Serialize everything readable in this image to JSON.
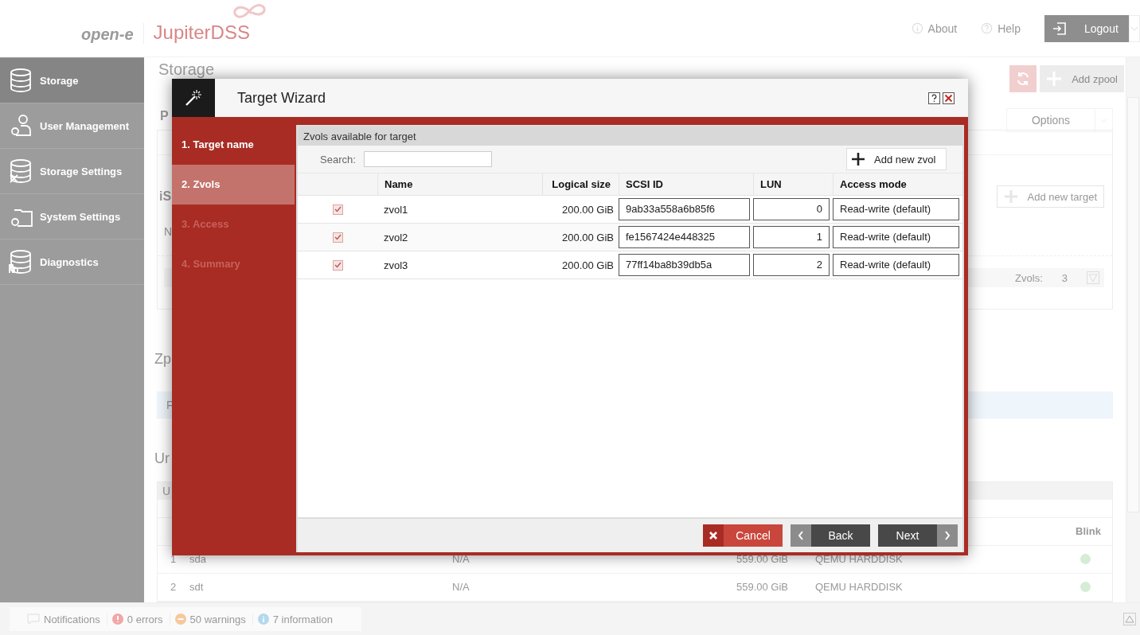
{
  "header": {
    "brand": "open-e",
    "product": "JupiterDSS",
    "links": [
      {
        "label": "About",
        "kind": "about"
      },
      {
        "label": "Help",
        "kind": "help"
      }
    ],
    "logout": "Logout"
  },
  "sidebar": {
    "items": [
      {
        "label": "Storage",
        "kind": "storage",
        "selected": true
      },
      {
        "label": "User Management",
        "kind": "users",
        "selected": false
      },
      {
        "label": "Storage Settings",
        "kind": "storage-settings",
        "selected": false
      },
      {
        "label": "System Settings",
        "kind": "system",
        "selected": false
      },
      {
        "label": "Diagnostics",
        "kind": "diagnostics",
        "selected": false
      }
    ]
  },
  "page": {
    "title": "Storage",
    "add_zpool": "Add zpool",
    "section_fragment": "P",
    "options": "Options",
    "target_fragment": "iS",
    "add_target": "Add new target",
    "name_fragment": "N",
    "zvols_label": "Zvols:",
    "zvols_count": "3",
    "zpools_fragment": "Zp",
    "info_fragment": "F",
    "unused_fragment": "Ur",
    "disks": {
      "header_fragment": "U",
      "blink_header": "Blink",
      "rows": [
        {
          "index": "1",
          "name": "sda",
          "column_3": "N/A",
          "size": "559.00 GiB",
          "model": "QEMU HARDDISK"
        },
        {
          "index": "2",
          "name": "sdt",
          "column_3": "N/A",
          "size": "559.00 GiB",
          "model": "QEMU HARDDISK"
        }
      ]
    }
  },
  "wizard": {
    "title": "Target Wizard",
    "steps": [
      {
        "label": "1. Target name",
        "selected": false,
        "disabled": false
      },
      {
        "label": "2. Zvols",
        "selected": true,
        "disabled": false
      },
      {
        "label": "3. Access",
        "selected": false,
        "disabled": true
      },
      {
        "label": "4. Summary",
        "selected": false,
        "disabled": true
      }
    ],
    "panel_title": "Zvols available for target",
    "search_label": "Search:",
    "add_zvol": "Add new zvol",
    "columns": [
      "Name",
      "Logical size",
      "SCSI ID",
      "LUN",
      "Access mode"
    ],
    "rows": [
      {
        "checked": true,
        "name": "zvol1",
        "size": "200.00 GiB",
        "scsi_id": "9ab33a558a6b85f6",
        "lun": "0",
        "access_mode": "Read-write (default)"
      },
      {
        "checked": true,
        "name": "zvol2",
        "size": "200.00 GiB",
        "scsi_id": "fe1567424e448325",
        "lun": "1",
        "access_mode": "Read-write (default)"
      },
      {
        "checked": true,
        "name": "zvol3",
        "size": "200.00 GiB",
        "scsi_id": "77ff14ba8b39db5a",
        "lun": "2",
        "access_mode": "Read-write (default)"
      }
    ],
    "cancel": "Cancel",
    "back": "Back",
    "next": "Next"
  },
  "status_bar": {
    "notifications": "Notifications",
    "items": [
      {
        "kind": "error",
        "label": "0 errors"
      },
      {
        "kind": "warning",
        "label": "50 warnings"
      },
      {
        "kind": "info",
        "label": "7 information"
      }
    ]
  }
}
